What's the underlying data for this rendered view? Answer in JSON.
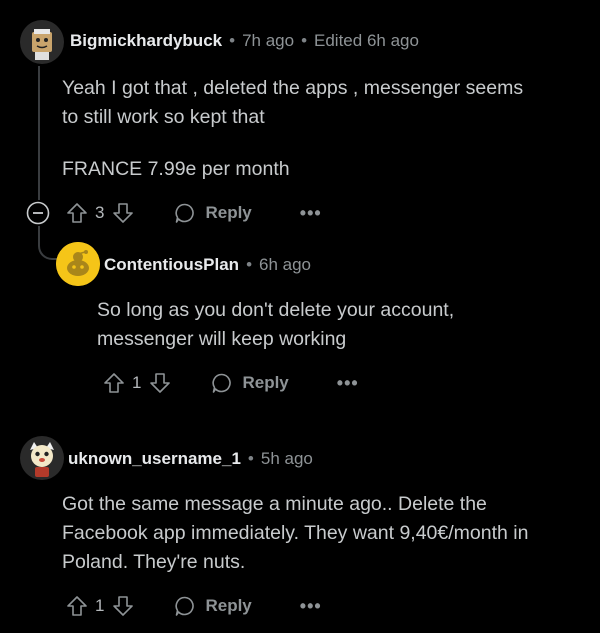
{
  "comments": [
    {
      "username": "Bigmickhardybuck",
      "time": "7h ago",
      "edited": "Edited 6h ago",
      "paragraphs": [
        "Yeah I got that , deleted the apps , messenger seems",
        "to still work so kept that"
      ],
      "extra": "FRANCE 7.99e per month",
      "votes": "3",
      "reply_label": "Reply",
      "more_label": "•••"
    },
    {
      "username": "ContentiousPlan",
      "time": "6h ago",
      "paragraphs": [
        "So long as you don't delete your account,",
        "messenger will keep working"
      ],
      "votes": "1",
      "reply_label": "Reply",
      "more_label": "•••"
    },
    {
      "username": "uknown_username_1",
      "time": "5h ago",
      "paragraphs": [
        "Got the same message a minute ago.. Delete the",
        "Facebook app immediately. They want 9,40€/month in",
        "Poland. They're nuts."
      ],
      "votes": "1",
      "reply_label": "Reply",
      "more_label": "•••"
    }
  ],
  "separator": "•",
  "colors": {
    "background": "#000000",
    "text": "#c8cbcd",
    "muted": "#8e9396",
    "thread_line": "#3a3d40",
    "snoo_yellow": "#f5c518"
  }
}
